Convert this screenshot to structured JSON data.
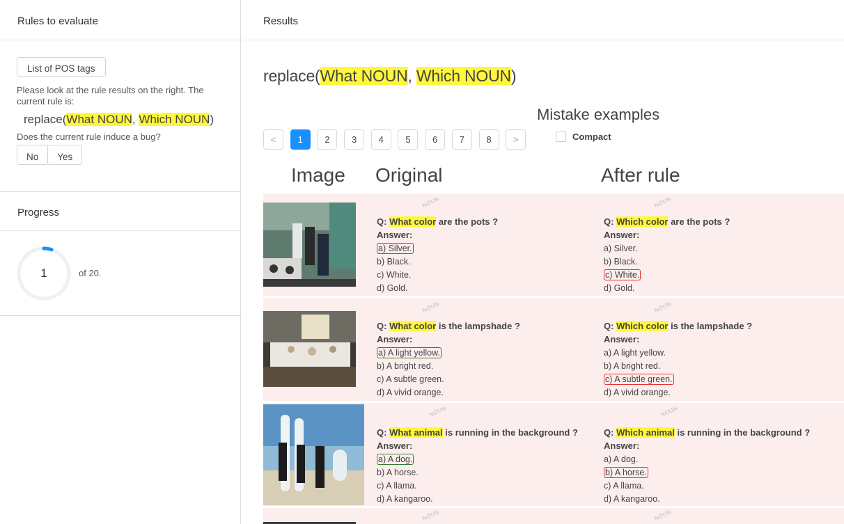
{
  "left": {
    "rules_title": "Rules to evaluate",
    "pos_button": "List of POS tags",
    "note": "Please look at the rule results on the right. The current rule is:",
    "rule": {
      "prefix": "replace(",
      "a": "What NOUN",
      "sep": ", ",
      "b": "Which NOUN",
      "suffix": ")"
    },
    "bug_question": "Does the current rule induce a bug?",
    "no": "No",
    "yes": "Yes",
    "progress_title": "Progress",
    "progress_value": "1",
    "progress_of": "of 20.",
    "progress_fraction": 0.05
  },
  "right": {
    "results_title": "Results",
    "rule": {
      "prefix": "replace(",
      "a": "What NOUN",
      "sep": ", ",
      "b": "Which NOUN",
      "suffix": ")"
    },
    "mistake_title": "Mistake examples",
    "pages": [
      "1",
      "2",
      "3",
      "4",
      "5",
      "6",
      "7",
      "8"
    ],
    "active_page": "1",
    "prev": "<",
    "next": ">",
    "compact_label": "Compact",
    "col_image": "Image",
    "col_original": "Original",
    "col_after": "After rule",
    "noun_tag": "NOUN",
    "answer_label": "Answer:",
    "q_prefix": "Q: ",
    "examples": [
      {
        "orig_hl": "What color",
        "after_hl": "Which color",
        "rest": " are the pots ?",
        "options": [
          "a) Silver.",
          "b) Black.",
          "c) White.",
          "d) Gold."
        ]
      },
      {
        "orig_hl": "What color",
        "after_hl": "Which color",
        "rest": " is the lampshade ?",
        "options": [
          "a) A light yellow.",
          "b) A bright red.",
          "c) A subtle green.",
          "d) A vivid orange."
        ]
      },
      {
        "orig_hl": "What animal",
        "after_hl": "Which animal",
        "rest": " is running in the background ?",
        "options": [
          "a) A dog.",
          "b) A horse.",
          "c) A llama.",
          "d) A kangaroo."
        ]
      }
    ]
  }
}
